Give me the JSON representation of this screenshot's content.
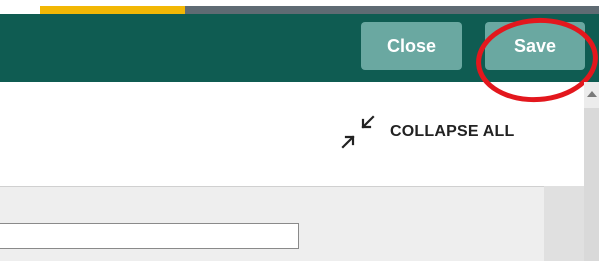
{
  "progress": {
    "fraction": 0.26,
    "track_color": "#5f6b73",
    "fill_color": "#f2b705"
  },
  "toolbar": {
    "background": "#0f5c52",
    "close_label": "Close",
    "save_label": "Save",
    "button_color": "#6aa8a1",
    "highlight_color": "#e3171d"
  },
  "content": {
    "collapse_all_label": "COLLAPSE ALL",
    "collapse_icon": "collapse-arrows-icon",
    "field_value": ""
  },
  "scrollbar": {
    "arrow_icon": "scroll-up-arrow-icon"
  }
}
